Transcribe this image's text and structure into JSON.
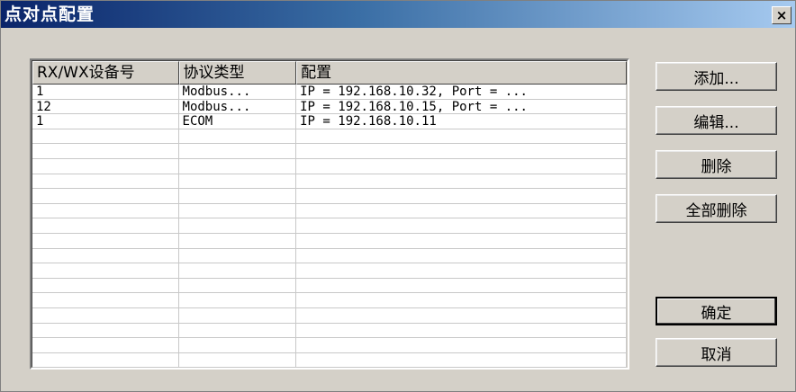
{
  "window": {
    "title": "点对点配置",
    "close_symbol": "×"
  },
  "table": {
    "columns": [
      "RX/WX设备号",
      "协议类型",
      "配置"
    ],
    "rows": [
      [
        "1",
        "Modbus...",
        "IP = 192.168.10.32, Port = ..."
      ],
      [
        "12",
        "Modbus...",
        "IP = 192.168.10.15, Port = ..."
      ],
      [
        "1",
        "ECOM",
        "IP = 192.168.10.11"
      ],
      [
        "",
        "",
        ""
      ],
      [
        "",
        "",
        ""
      ],
      [
        "",
        "",
        ""
      ],
      [
        "",
        "",
        ""
      ],
      [
        "",
        "",
        ""
      ],
      [
        "",
        "",
        ""
      ],
      [
        "",
        "",
        ""
      ],
      [
        "",
        "",
        ""
      ],
      [
        "",
        "",
        ""
      ],
      [
        "",
        "",
        ""
      ],
      [
        "",
        "",
        ""
      ],
      [
        "",
        "",
        ""
      ],
      [
        "",
        "",
        ""
      ],
      [
        "",
        "",
        ""
      ],
      [
        "",
        "",
        ""
      ],
      [
        "",
        "",
        ""
      ]
    ]
  },
  "buttons": {
    "add": "添加...",
    "edit": "编辑...",
    "delete": "删除",
    "delete_all": "全部删除",
    "ok": "确定",
    "cancel": "取消"
  }
}
